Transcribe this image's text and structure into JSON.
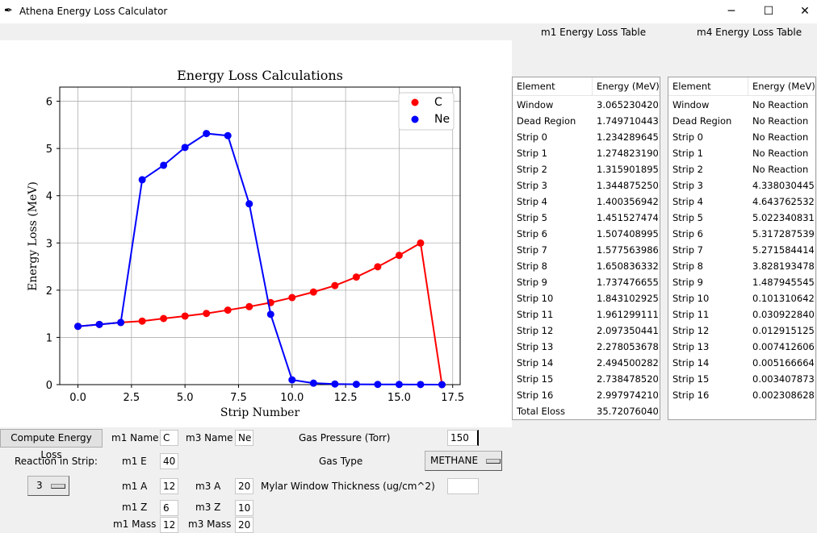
{
  "window": {
    "title": "Athena Energy Loss Calculator",
    "icon": "feather-icon",
    "minimize": "─",
    "maximize": "☐",
    "close": "✕"
  },
  "chart_data": {
    "type": "line",
    "title": "Energy Loss Calculations",
    "xlabel": "Strip Number",
    "ylabel": "Energy Loss (MeV)",
    "xlim": [
      -0.85,
      17.85
    ],
    "ylim": [
      0,
      6.3
    ],
    "xticks": [
      "0.0",
      "2.5",
      "5.0",
      "7.5",
      "10.0",
      "12.5",
      "15.0",
      "17.5"
    ],
    "yticks": [
      "0",
      "1",
      "2",
      "3",
      "4",
      "5",
      "6"
    ],
    "grid": true,
    "legend": "top-right",
    "x": [
      0,
      1,
      2,
      3,
      4,
      5,
      6,
      7,
      8,
      9,
      10,
      11,
      12,
      13,
      14,
      15,
      16,
      17
    ],
    "series": [
      {
        "name": "C",
        "color": "#ff0000",
        "values": [
          1.234,
          1.275,
          1.316,
          1.345,
          1.4,
          1.452,
          1.507,
          1.578,
          1.651,
          1.737,
          1.843,
          1.961,
          2.097,
          2.278,
          2.495,
          2.738,
          2.998,
          0.0
        ]
      },
      {
        "name": "Ne",
        "color": "#0000ff",
        "values": [
          1.234,
          1.275,
          1.316,
          4.338,
          4.644,
          5.022,
          5.317,
          5.272,
          3.828,
          1.488,
          0.101,
          0.031,
          0.013,
          0.0074,
          0.0052,
          0.0034,
          0.0023,
          0.0
        ]
      }
    ]
  },
  "m1_table": {
    "title": "m1 Energy Loss Table",
    "headers": [
      "Element",
      "Energy (MeV)"
    ],
    "rows": [
      [
        "Window",
        "3.06523042087"
      ],
      [
        "Dead Region",
        "1.74971044349"
      ],
      [
        "Strip 0",
        "1.23428964593"
      ],
      [
        "Strip 1",
        "1.27482319090"
      ],
      [
        "Strip 2",
        "1.31590189521"
      ],
      [
        "Strip 3",
        "1.34487525032"
      ],
      [
        "Strip 4",
        "1.40035694265"
      ],
      [
        "Strip 5",
        "1.45152747499"
      ],
      [
        "Strip 6",
        "1.50740899542"
      ],
      [
        "Strip 7",
        "1.57756398655"
      ],
      [
        "Strip 8",
        "1.65083633267"
      ],
      [
        "Strip 9",
        "1.73747665537"
      ],
      [
        "Strip 10",
        "1.84310292518"
      ],
      [
        "Strip 11",
        "1.96129911134"
      ],
      [
        "Strip 12",
        "2.09735044185"
      ],
      [
        "Strip 13",
        "2.27805367870"
      ],
      [
        "Strip 14",
        "2.49450028270"
      ],
      [
        "Strip 15",
        "2.73847852047"
      ],
      [
        "Strip 16",
        "2.99797421026"
      ],
      [
        "Total Eloss",
        "35.7207604049"
      ]
    ]
  },
  "m4_table": {
    "title": "m4 Energy Loss Table",
    "headers": [
      "Element",
      "Energy (MeV)"
    ],
    "rows": [
      [
        "Window",
        "No Reaction"
      ],
      [
        "Dead Region",
        "No Reaction"
      ],
      [
        "Strip 0",
        "No Reaction"
      ],
      [
        "Strip 1",
        "No Reaction"
      ],
      [
        "Strip 2",
        "No Reaction"
      ],
      [
        "Strip 3",
        "4.33803044586"
      ],
      [
        "Strip 4",
        "4.64376253244"
      ],
      [
        "Strip 5",
        "5.02234083168"
      ],
      [
        "Strip 6",
        "5.31728753949"
      ],
      [
        "Strip 7",
        "5.27158441437"
      ],
      [
        "Strip 8",
        "3.82819347894"
      ],
      [
        "Strip 9",
        "1.48794554564"
      ],
      [
        "Strip 10",
        "0.10131064253"
      ],
      [
        "Strip 11",
        "0.03092284048"
      ],
      [
        "Strip 12",
        "0.01291512532"
      ],
      [
        "Strip 13",
        "0.00741260664"
      ],
      [
        "Strip 14",
        "0.00516666478"
      ],
      [
        "Strip 15",
        "0.00340787317"
      ],
      [
        "Strip 16",
        "0.00230862824"
      ]
    ]
  },
  "controls": {
    "compute_button": "Compute Energy Loss",
    "reaction_label": "Reaction in Strip:",
    "reaction_value": "3",
    "m1_name_label": "m1 Name",
    "m1_name": "C",
    "m3_name_label": "m3 Name",
    "m3_name": "Ne",
    "m1_e_label": "m1 E",
    "m1_e": "40",
    "m1_a_label": "m1 A",
    "m1_a": "12",
    "m3_a_label": "m3 A",
    "m3_a": "20",
    "m1_z_label": "m1 Z",
    "m1_z": "6",
    "m3_z_label": "m3 Z",
    "m3_z": "10",
    "m1_mass_label": "m1 Mass",
    "m1_mass": "12",
    "m3_mass_label": "m3 Mass",
    "m3_mass": "20",
    "gas_pressure_label": "Gas Pressure (Torr)",
    "gas_pressure": "150",
    "gas_type_label": "Gas Type",
    "gas_type": "METHANE",
    "mylar_label": "Mylar Window Thickness (ug/cm^2)",
    "mylar": ""
  }
}
